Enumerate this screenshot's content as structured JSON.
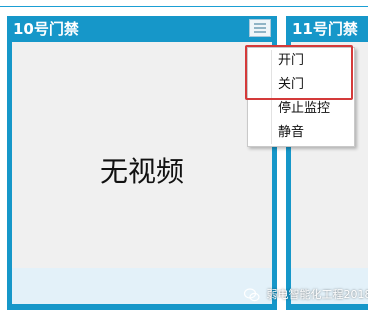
{
  "panels": [
    {
      "title": "10号门禁",
      "body_text": "无视频"
    },
    {
      "title": "11号门禁"
    }
  ],
  "context_menu": {
    "items": [
      {
        "label": "开门"
      },
      {
        "label": "关门"
      },
      {
        "label": "停止监控"
      },
      {
        "label": "静音"
      }
    ],
    "highlighted_items": [
      "开门",
      "关门"
    ]
  },
  "watermark": {
    "text": "弱电智能化工程2018"
  },
  "colors": {
    "panel_frame": "#1697c9",
    "panel_body": "#f0f0f0",
    "panel_footer": "#e3f1f9",
    "highlight_border": "#d43a3a"
  }
}
